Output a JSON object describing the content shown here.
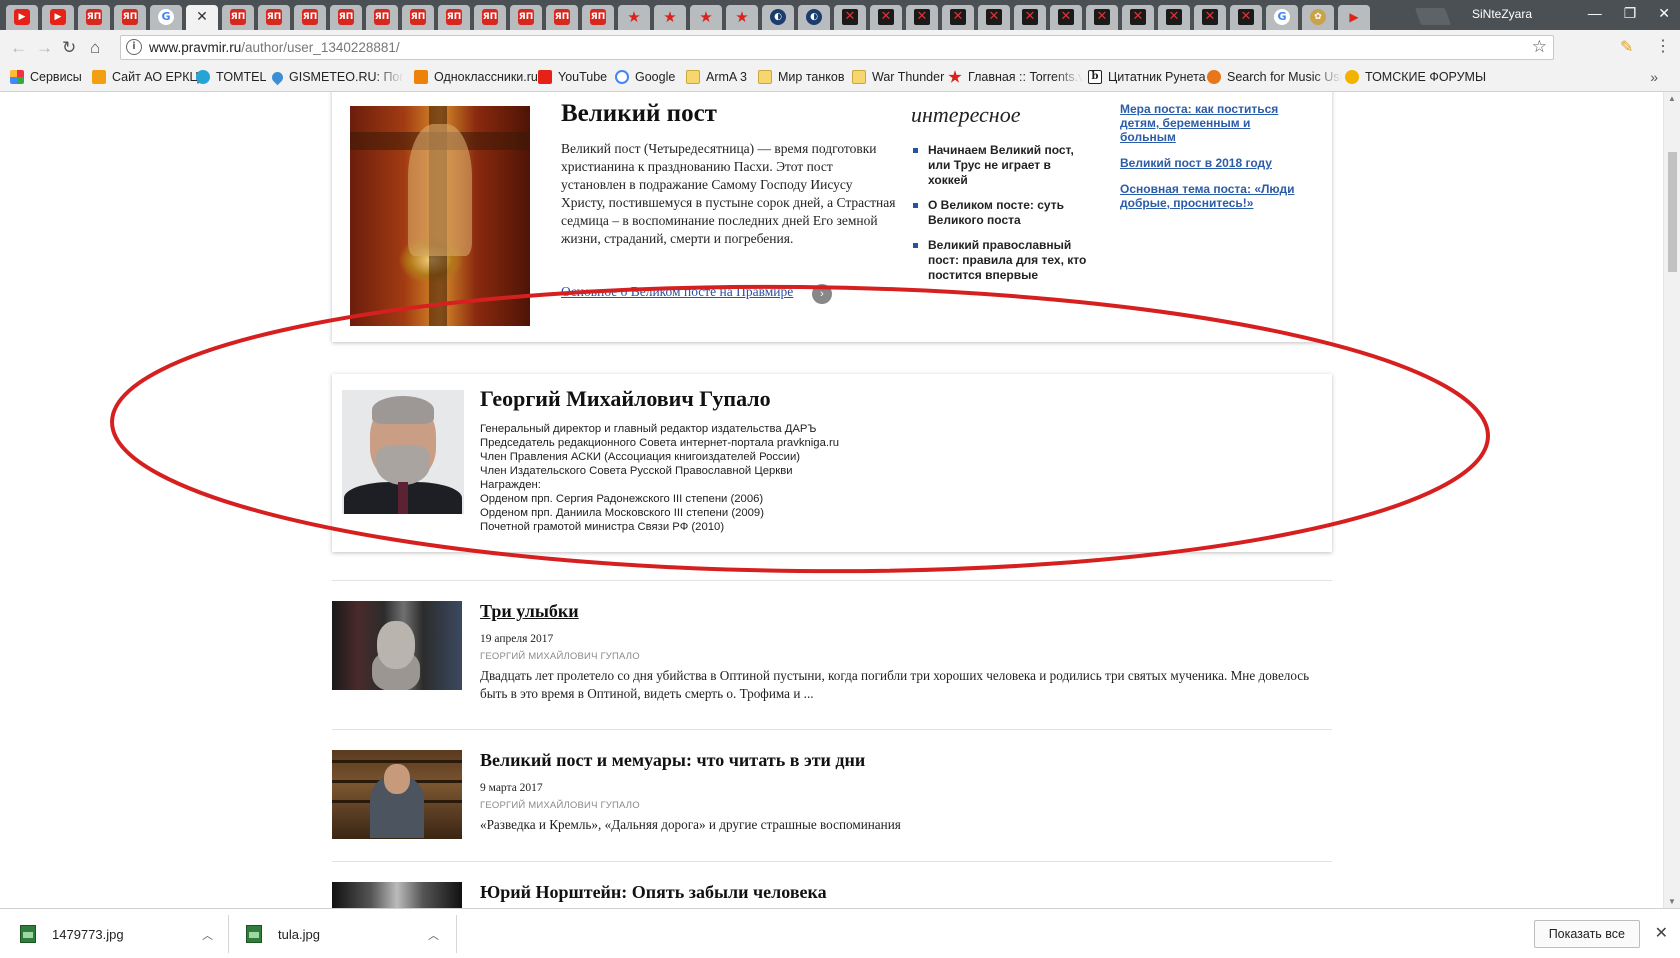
{
  "browser": {
    "tabs": [
      {
        "icon": "youtube-icon",
        "glyph": "▶",
        "cls": "yt"
      },
      {
        "icon": "youtube-icon",
        "glyph": "▶",
        "cls": "yt"
      },
      {
        "icon": "pravmir-icon",
        "glyph": "ЯП",
        "cls": "pm"
      },
      {
        "icon": "pravmir-icon",
        "glyph": "ЯП",
        "cls": "pm"
      },
      {
        "icon": "google-icon",
        "glyph": "G",
        "cls": "g"
      },
      {
        "icon": "close-icon",
        "glyph": "✕",
        "cls": "",
        "active": true
      },
      {
        "icon": "pravmir-icon",
        "glyph": "ЯП",
        "cls": "pm"
      },
      {
        "icon": "pravmir-icon",
        "glyph": "ЯП",
        "cls": "pm"
      },
      {
        "icon": "pravmir-icon",
        "glyph": "ЯП",
        "cls": "pm"
      },
      {
        "icon": "pravmir-icon",
        "glyph": "ЯП",
        "cls": "pm"
      },
      {
        "icon": "pravmir-icon",
        "glyph": "ЯП",
        "cls": "pm"
      },
      {
        "icon": "pravmir-icon",
        "glyph": "ЯП",
        "cls": "pm"
      },
      {
        "icon": "pravmir-icon",
        "glyph": "ЯП",
        "cls": "pm"
      },
      {
        "icon": "pravmir-icon",
        "glyph": "ЯП",
        "cls": "pm"
      },
      {
        "icon": "pravmir-icon",
        "glyph": "ЯП",
        "cls": "pm"
      },
      {
        "icon": "pravmir-icon",
        "glyph": "ЯП",
        "cls": "pm"
      },
      {
        "icon": "pravmir-icon",
        "glyph": "ЯП",
        "cls": "pm"
      },
      {
        "icon": "star-icon",
        "glyph": "★",
        "cls": "star"
      },
      {
        "icon": "star-icon",
        "glyph": "★",
        "cls": "star"
      },
      {
        "icon": "star-icon",
        "glyph": "★",
        "cls": "star"
      },
      {
        "icon": "star-icon",
        "glyph": "★",
        "cls": "star"
      },
      {
        "icon": "moon-icon",
        "glyph": "◐",
        "cls": "moon"
      },
      {
        "icon": "moon-icon",
        "glyph": "◐",
        "cls": "moon"
      },
      {
        "icon": "x-icon",
        "glyph": "✕",
        "cls": "x"
      },
      {
        "icon": "x-icon",
        "glyph": "✕",
        "cls": "x"
      },
      {
        "icon": "x-icon",
        "glyph": "✕",
        "cls": "x"
      },
      {
        "icon": "x-icon",
        "glyph": "✕",
        "cls": "x"
      },
      {
        "icon": "x-icon",
        "glyph": "✕",
        "cls": "x"
      },
      {
        "icon": "x-icon",
        "glyph": "✕",
        "cls": "x"
      },
      {
        "icon": "x-icon",
        "glyph": "✕",
        "cls": "x"
      },
      {
        "icon": "x-icon",
        "glyph": "✕",
        "cls": "x"
      },
      {
        "icon": "x-icon",
        "glyph": "✕",
        "cls": "x"
      },
      {
        "icon": "x-icon",
        "glyph": "✕",
        "cls": "x"
      },
      {
        "icon": "x-icon",
        "glyph": "✕",
        "cls": "x"
      },
      {
        "icon": "x-icon",
        "glyph": "✕",
        "cls": "x"
      },
      {
        "icon": "google-icon",
        "glyph": "G",
        "cls": "g"
      },
      {
        "icon": "cog-icon",
        "glyph": "✿",
        "cls": "cog"
      },
      {
        "icon": "play-icon",
        "glyph": "▶",
        "cls": "play"
      }
    ],
    "user_name": "SiNteZyara",
    "url_host": "www.pravmir.ru",
    "url_path": "/author/user_1340228881/",
    "bookmarks": [
      {
        "label": "Сервисы",
        "icon": "grid"
      },
      {
        "label": "Сайт АО ЕРКЦ",
        "icon": "house"
      },
      {
        "label": "TOMTEL",
        "icon": "tom"
      },
      {
        "label": "GISMETEO.RU: Погод",
        "icon": "drop",
        "fade": true
      },
      {
        "label": "Одноклассники.ru",
        "icon": "ok"
      },
      {
        "label": "YouTube",
        "icon": "yt"
      },
      {
        "label": "Google",
        "icon": "gg"
      },
      {
        "label": "ArmA 3",
        "icon": "folder"
      },
      {
        "label": "Мир танков",
        "icon": "folder"
      },
      {
        "label": "War Thunder",
        "icon": "folder"
      },
      {
        "label": "Главная :: Torrents.vt",
        "icon": "star",
        "fade": true
      },
      {
        "label": "Цитатник Рунета",
        "icon": "b"
      },
      {
        "label": "Search for Music Usin",
        "icon": "music",
        "fade": true
      },
      {
        "label": "ТОМСКИЕ ФОРУМЫ",
        "icon": "tf"
      }
    ]
  },
  "lent": {
    "title": "Великий пост",
    "text": "Великий пост (Четыредесятница) — время подготовки христианина к празднованию Пасхи. Этот пост установлен в подражание Самому Господу Иисусу Христу, постившемуся в пустыне сорок дней, а Страстная седмица – в воспоминание последних дней Его земной жизни, страданий, смерти и погребения.",
    "link": "Основное о Великом посте на Правмире",
    "interest_title": "интересное",
    "interest_items": [
      "Начинаем Великий пост, или Трус не играет в хоккей",
      "О Великом посте: суть Великого поста",
      "Великий православный пост: правила для тех, кто постится впервые"
    ],
    "links": [
      "Мера поста: как поститься детям, беременным и больным",
      "Великий пост в 2018 году",
      "Основная тема поста: «Люди добрые, проснитесь!»"
    ]
  },
  "author": {
    "name": "Георгий Михайлович Гупало",
    "bio": [
      "Генеральный директор и главный редактор издательства ДАРЪ",
      "Председатель редакционного Совета интернет-портала pravkniga.ru",
      "Член Правления АСКИ (Ассоциация книгоиздателей России)",
      "Член Издательского Совета Русской Православной Церкви",
      "Награжден:",
      "Орденом прп. Сергия Радонежского III степени (2006)",
      "Орденом прп. Даниила Московского III степени (2009)",
      "Почетной грамотой министра Связи РФ (2010)"
    ]
  },
  "articles": [
    {
      "title": "Три улыбки",
      "date": "19 апреля 2017",
      "byline": "ГЕОРГИЙ МИХАЙЛОВИЧ ГУПАЛО",
      "excerpt": "Двадцать лет пролетело со дня убийства в Оптиной пустыни, когда погибли три хороших человека и родились три святых мученика. Мне довелось быть в это время в Оптиной, видеть смерть о. Трофима и ..."
    },
    {
      "title": "Великий пост и мемуары: что читать в эти дни",
      "date": "9 марта 2017",
      "byline": "ГЕОРГИЙ МИХАЙЛОВИЧ ГУПАЛО",
      "excerpt": "«Разведка и Кремль», «Дальняя дорога» и другие страшные воспоминания"
    },
    {
      "title": "Юрий Норштейн: Опять забыли человека"
    }
  ],
  "downloads": {
    "files": [
      "1479773.jpg",
      "tula.jpg"
    ],
    "show_all": "Показать все"
  },
  "colors": {
    "annotation_ellipse": "#d62020",
    "link": "#2553a5"
  }
}
